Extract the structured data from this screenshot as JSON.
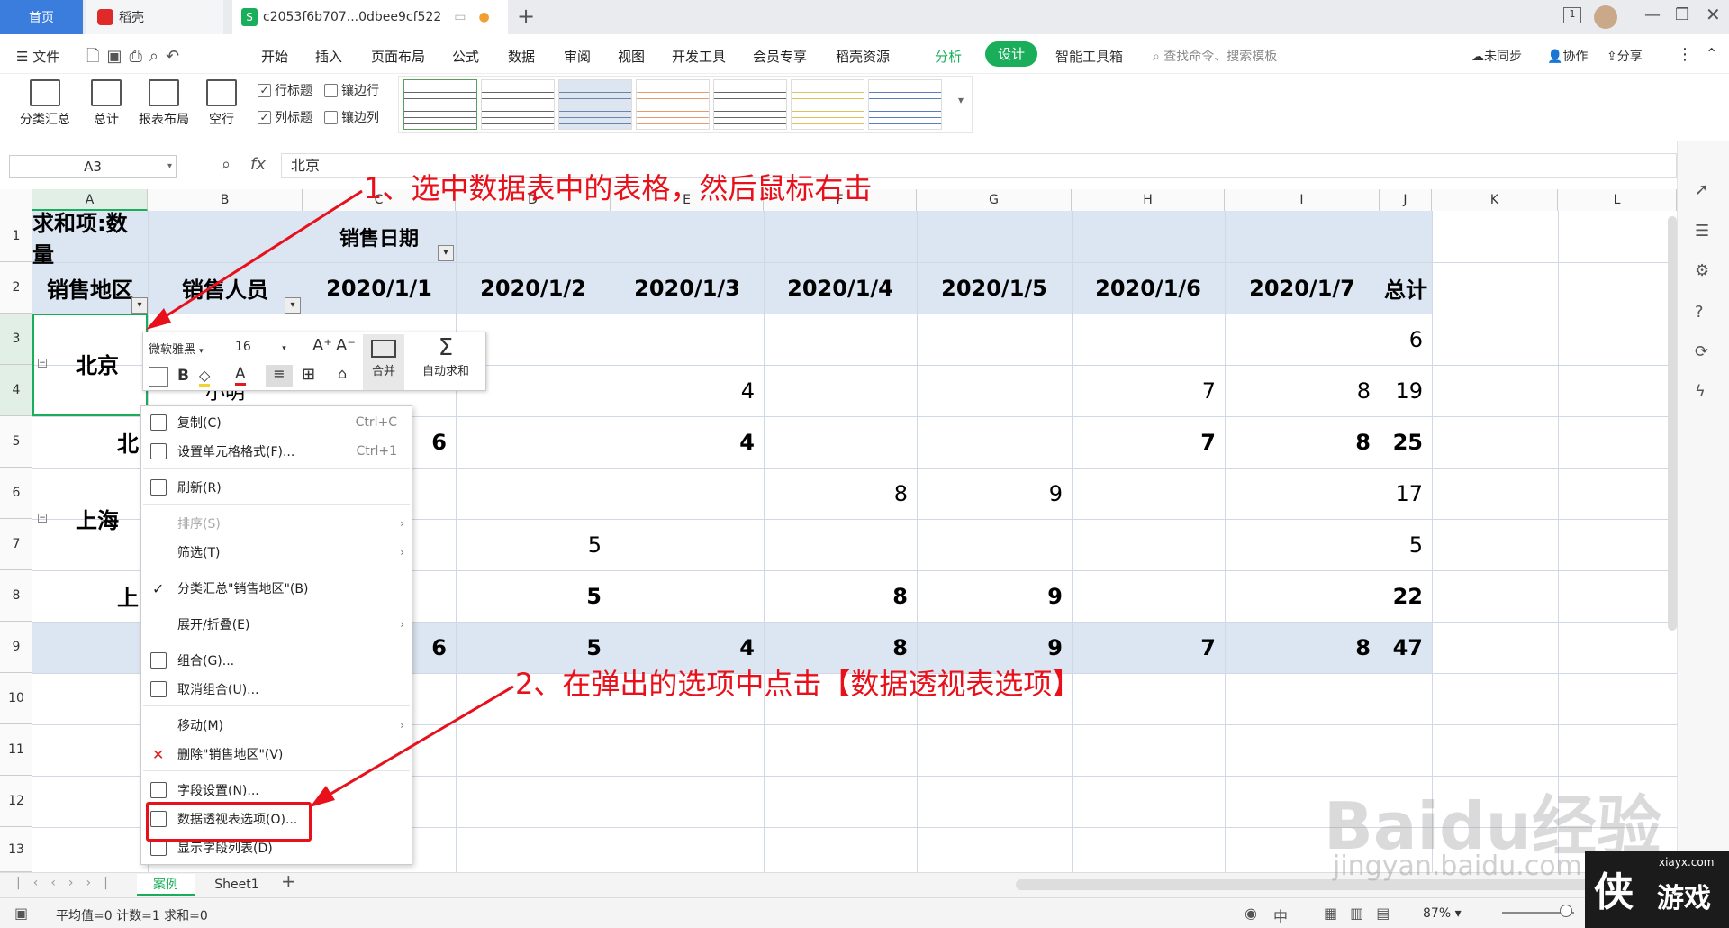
{
  "tabs": {
    "home": "首页",
    "daoke": "稻壳",
    "file": "c2053f6b707...0dbee9cf522"
  },
  "menubar": {
    "file": "文件",
    "items": [
      "开始",
      "插入",
      "页面布局",
      "公式",
      "数据",
      "审阅",
      "视图",
      "开发工具",
      "会员专享",
      "稻壳资源"
    ],
    "analyze": "分析",
    "design": "设计",
    "toolbox": "智能工具箱",
    "search": "查找命令、搜索模板",
    "sync": "未同步",
    "collab": "协作",
    "share": "分享"
  },
  "ribbon": {
    "subtotal": "分类汇总",
    "total": "总计",
    "layout": "报表布局",
    "blank": "空行",
    "row_header": "行标题",
    "banded_rows": "镶边行",
    "col_header": "列标题",
    "banded_cols": "镶边列"
  },
  "formula": {
    "namebox": "A3",
    "fx": "fx",
    "value": "北京"
  },
  "columns": [
    "A",
    "B",
    "C",
    "D",
    "E",
    "F",
    "G",
    "H",
    "I",
    "J",
    "K",
    "L"
  ],
  "rows": [
    "1",
    "2",
    "3",
    "4",
    "5",
    "6",
    "7",
    "8",
    "9",
    "10",
    "11",
    "12",
    "13"
  ],
  "cells": {
    "a1": "求和项:数量",
    "c1": "销售日期",
    "a2": "销售地区",
    "b2": "销售人员",
    "dates": [
      "2020/1/1",
      "2020/1/2",
      "2020/1/3",
      "2020/1/4",
      "2020/1/5",
      "2020/1/6",
      "2020/1/7"
    ],
    "total": "总计",
    "a3": "北京",
    "b4": "小明",
    "a5": "北",
    "a6": "上海",
    "a8": "上",
    "r3": {
      "j": "6"
    },
    "r4": {
      "d": "4",
      "h": "7",
      "i": "8",
      "j": "19"
    },
    "r5": {
      "c": "6",
      "d": "4",
      "h": "7",
      "i": "8",
      "j": "25"
    },
    "r6": {
      "f": "8",
      "g": "9",
      "j": "17"
    },
    "r7": {
      "d": "5",
      "j": "5"
    },
    "r8": {
      "d": "5",
      "f": "8",
      "g": "9",
      "j": "22"
    },
    "r9": {
      "c": "6",
      "d": "5",
      "e": "4",
      "f": "8",
      "g": "9",
      "h": "7",
      "i": "8",
      "j": "47"
    }
  },
  "minitoolbar": {
    "font": "微软雅黑",
    "size": "16",
    "bold": "B",
    "fontcolor": "A",
    "merge": "合并",
    "autosum": "自动求和"
  },
  "contextmenu": [
    {
      "label": "复制(C)",
      "shortcut": "Ctrl+C"
    },
    {
      "label": "设置单元格格式(F)...",
      "shortcut": "Ctrl+1"
    },
    {
      "label": "刷新(R)"
    },
    {
      "label": "排序(S)"
    },
    {
      "label": "筛选(T)"
    },
    {
      "label": "分类汇总\"销售地区\"(B)"
    },
    {
      "label": "展开/折叠(E)"
    },
    {
      "label": "组合(G)..."
    },
    {
      "label": "取消组合(U)..."
    },
    {
      "label": "移动(M)"
    },
    {
      "label": "删除\"销售地区\"(V)"
    },
    {
      "label": "字段设置(N)..."
    },
    {
      "label": "数据透视表选项(O)..."
    },
    {
      "label": "显示字段列表(D)"
    }
  ],
  "annotations": {
    "step1": "1、选中数据表中的表格，然后鼠标右击",
    "step2": "2、在弹出的选项中点击【数据透视表选项】"
  },
  "sheets": {
    "active": "案例",
    "other": "Sheet1"
  },
  "status": {
    "summary": "平均值=0  计数=1  求和=0",
    "zoom": "87%"
  },
  "watermark": {
    "brand": "Baidu经验",
    "url": "jingyan.baidu.com",
    "site": "xiayx.com",
    "sitename": "游戏"
  },
  "colors": {
    "accent_green": "#1aad5a",
    "header_blue": "#dce6f2",
    "annotation_red": "#e8101a",
    "tab_blue": "#3b7ddd"
  }
}
